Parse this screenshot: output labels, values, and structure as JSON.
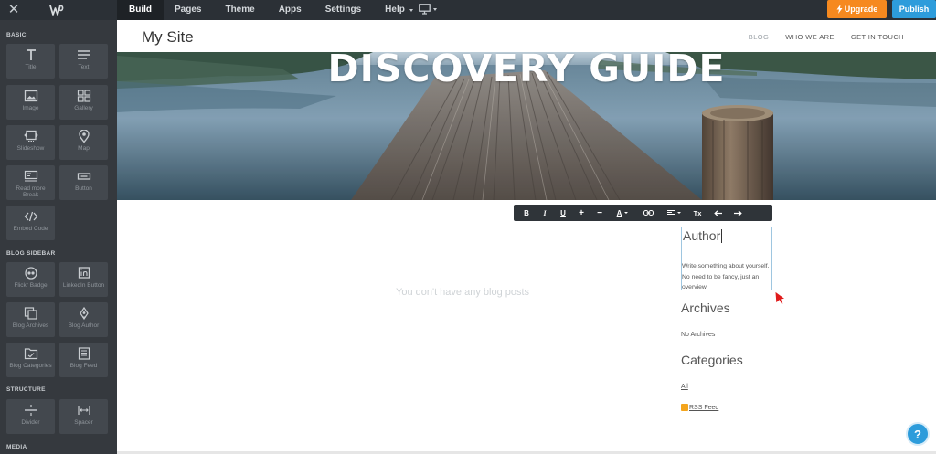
{
  "topbar": {
    "nav": [
      {
        "label": "Build",
        "active": true
      },
      {
        "label": "Pages"
      },
      {
        "label": "Theme"
      },
      {
        "label": "Apps"
      },
      {
        "label": "Settings"
      },
      {
        "label": "Help",
        "dropdown": true
      }
    ],
    "upgrade_label": "Upgrade",
    "publish_label": "Publish",
    "upgrade_color": "#f6891f",
    "publish_color": "#2d9cdb"
  },
  "sidebar": {
    "sections": {
      "basic": "BASIC",
      "blog_sidebar": "BLOG SIDEBAR",
      "structure": "STRUCTURE",
      "media": "MEDIA"
    },
    "basic": [
      {
        "label": "Title",
        "icon": "title-icon"
      },
      {
        "label": "Text",
        "icon": "text-icon"
      },
      {
        "label": "Image",
        "icon": "image-icon"
      },
      {
        "label": "Gallery",
        "icon": "gallery-icon"
      },
      {
        "label": "Slideshow",
        "icon": "slideshow-icon"
      },
      {
        "label": "Map",
        "icon": "map-pin-icon"
      },
      {
        "label": "Read more Break",
        "icon": "read-more-icon"
      },
      {
        "label": "Button",
        "icon": "button-icon"
      },
      {
        "label": "Embed Code",
        "icon": "code-icon"
      }
    ],
    "blog": [
      {
        "label": "Flickr Badge",
        "icon": "flickr-icon"
      },
      {
        "label": "LinkedIn Button",
        "icon": "linkedin-icon"
      },
      {
        "label": "Blog Archives",
        "icon": "archives-icon"
      },
      {
        "label": "Blog Author",
        "icon": "author-icon"
      },
      {
        "label": "Blog Categories",
        "icon": "folder-icon"
      },
      {
        "label": "Blog Feed",
        "icon": "feed-icon"
      }
    ],
    "structure": [
      {
        "label": "Divider",
        "icon": "divider-icon"
      },
      {
        "label": "Spacer",
        "icon": "spacer-icon"
      }
    ]
  },
  "site": {
    "title": "My Site",
    "nav": [
      "BLOG",
      "WHO WE ARE",
      "GET IN TOUCH"
    ],
    "hero_title": "DISCOVERY GUIDE",
    "empty_message": "You don't have any blog posts"
  },
  "toolbar": {
    "bold": "B",
    "italic": "I",
    "underline": "U",
    "plus": "+",
    "minus": "−",
    "font_color": "A",
    "clear_format": "Tx"
  },
  "blog_sidebar": {
    "author_heading": "Author",
    "author_text": "Write something about yourself. No need to be fancy, just an overview.",
    "archives_heading": "Archives",
    "archives_text": "No Archives",
    "categories_heading": "Categories",
    "all_link": "All",
    "rss_link": "RSS Feed"
  },
  "help_label": "?"
}
